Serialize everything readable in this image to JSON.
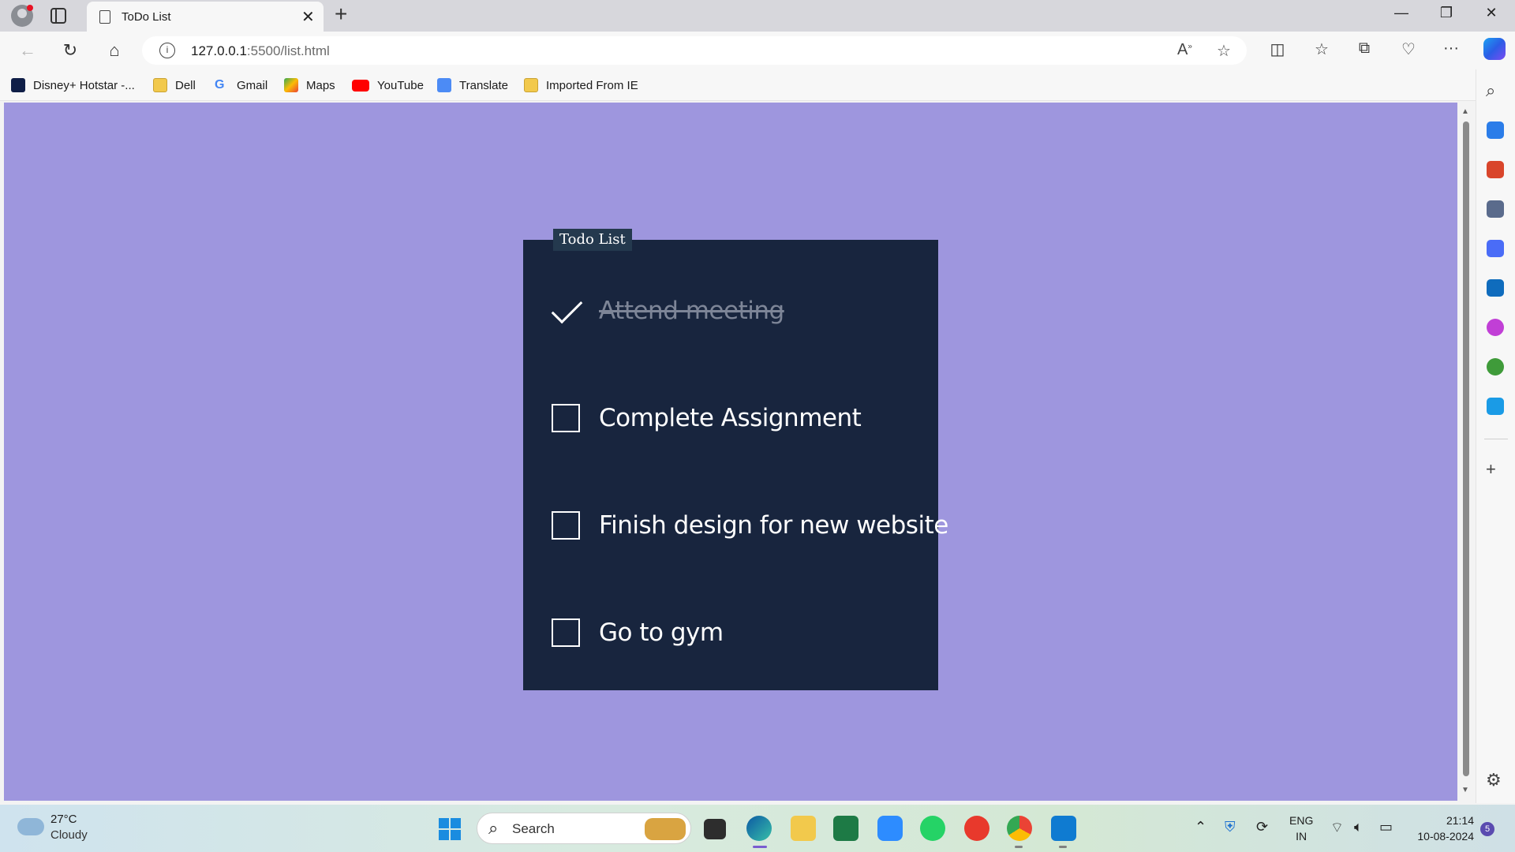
{
  "browser": {
    "tab_title": "ToDo List",
    "url_host": "127.0.0.1",
    "url_rest": ":5500/list.html",
    "bookmarks": [
      {
        "label": "Disney+ Hotstar -...",
        "icon": "hotstar-icon"
      },
      {
        "label": "Dell",
        "icon": "folder-icon"
      },
      {
        "label": "Gmail",
        "icon": "google-icon"
      },
      {
        "label": "Maps",
        "icon": "maps-icon"
      },
      {
        "label": "YouTube",
        "icon": "youtube-icon"
      },
      {
        "label": "Translate",
        "icon": "translate-icon"
      },
      {
        "label": "Imported From IE",
        "icon": "folder-icon"
      }
    ]
  },
  "page": {
    "background_color": "#9e96de",
    "card_color": "#18253e",
    "title": "Todo List",
    "items": [
      {
        "text": "Attend meeting",
        "done": true
      },
      {
        "text": "Complete Assignment",
        "done": false
      },
      {
        "text": "Finish design for new website",
        "done": false
      },
      {
        "text": "Go to gym",
        "done": false
      }
    ]
  },
  "taskbar": {
    "weather_temp": "27°C",
    "weather_desc": "Cloudy",
    "search_placeholder": "Search",
    "lang_line1": "ENG",
    "lang_line2": "IN",
    "time": "21:14",
    "date": "10-08-2024",
    "notification_count": "5"
  }
}
